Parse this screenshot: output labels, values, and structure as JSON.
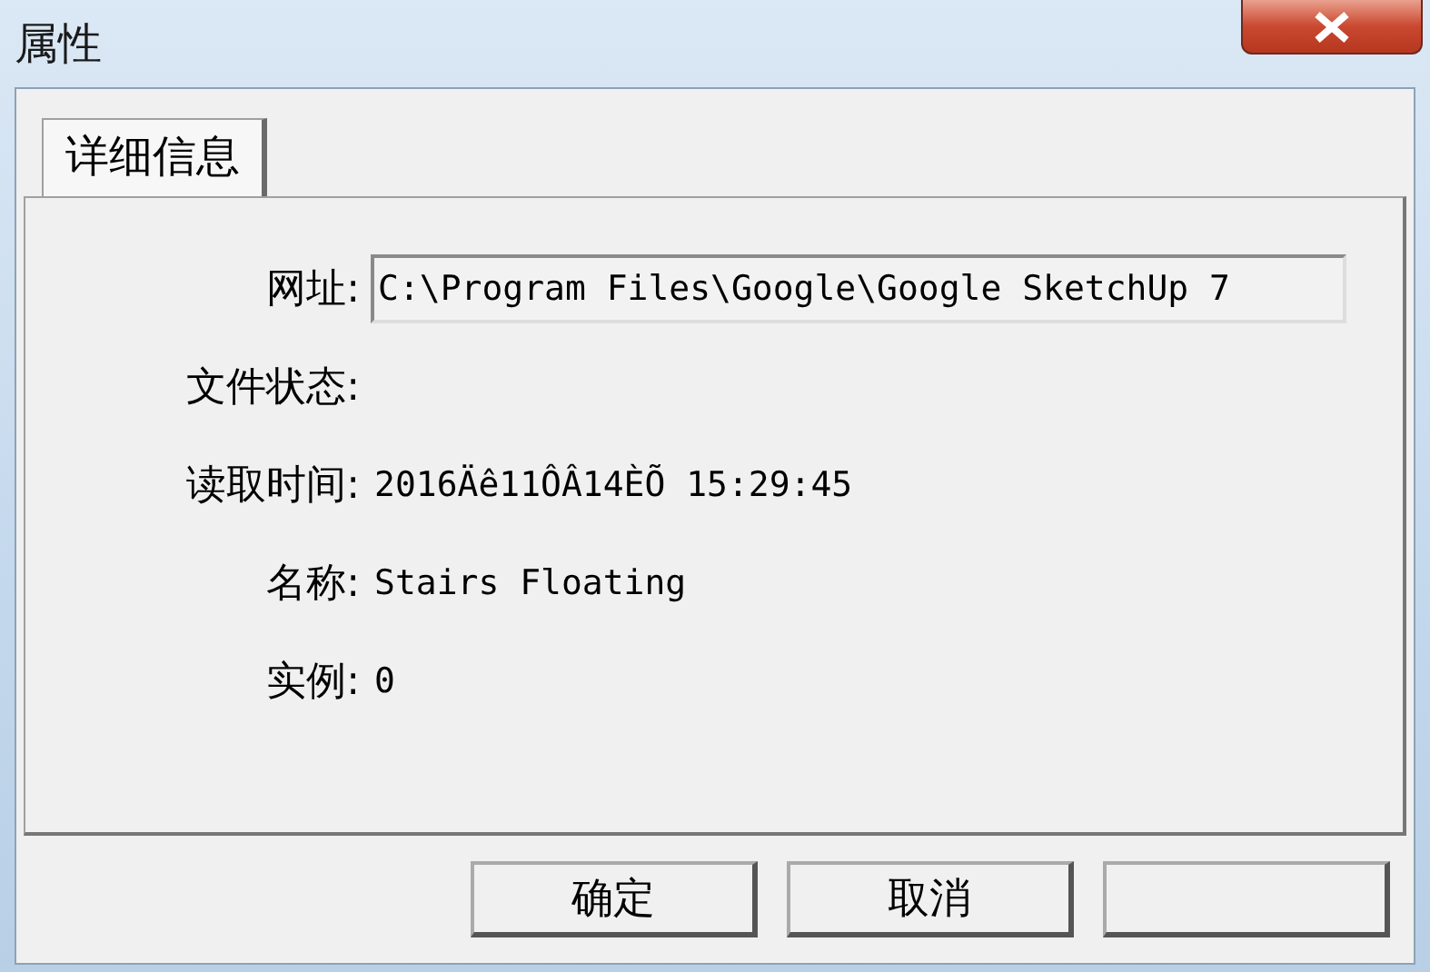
{
  "window": {
    "title": "属性"
  },
  "tabs": [
    {
      "label": "详细信息",
      "selected": true
    }
  ],
  "fields": [
    {
      "kind": "input",
      "label": "网址:",
      "value": "C:\\Program Files\\Google\\Google SketchUp 7"
    },
    {
      "kind": "text",
      "label": "文件状态:"
    },
    {
      "kind": "text",
      "label": "读取时间:",
      "value": "2016Äê11ÔÂ14ÈÕ 15:29:45"
    },
    {
      "kind": "text",
      "label": "名称:",
      "value": "Stairs Floating"
    },
    {
      "kind": "text",
      "label": "实例:",
      "value": "0"
    }
  ],
  "buttons": [
    {
      "kind": "labeled",
      "label": "确定"
    },
    {
      "kind": "labeled",
      "label": "取消"
    },
    {
      "kind": "blank"
    }
  ]
}
